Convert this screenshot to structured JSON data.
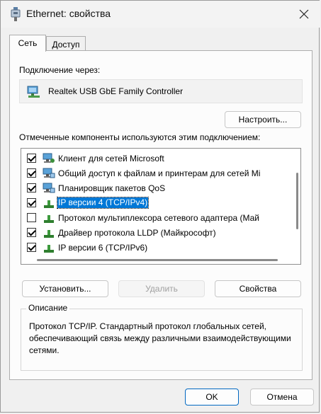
{
  "window": {
    "title": "Ethernet: свойства"
  },
  "tabs": [
    {
      "label": "Сеть"
    },
    {
      "label": "Доступ"
    }
  ],
  "connect_using": {
    "label": "Подключение через:",
    "adapter": "Realtek USB GbE Family Controller",
    "configure_button": "Настроить..."
  },
  "components": {
    "label": "Отмеченные компоненты используются этим подключением:",
    "items": [
      {
        "label": "Клиент для сетей Microsoft",
        "checked": true,
        "icon": "network-client-icon"
      },
      {
        "label": "Общий доступ к файлам и принтерам для сетей Mi",
        "checked": true,
        "icon": "network-service-icon"
      },
      {
        "label": "Планировщик пакетов QoS",
        "checked": true,
        "icon": "network-service-icon"
      },
      {
        "label": "IP версии 4 (TCP/IPv4)",
        "checked": true,
        "icon": "protocol-icon",
        "selected": true
      },
      {
        "label": "Протокол мультиплексора сетевого адаптера (Май",
        "checked": false,
        "icon": "protocol-icon"
      },
      {
        "label": "Драйвер протокола LLDP (Майкрософт)",
        "checked": true,
        "icon": "protocol-icon"
      },
      {
        "label": "IP версии 6 (TCP/IPv6)",
        "checked": true,
        "icon": "protocol-icon"
      }
    ]
  },
  "actions": {
    "install": "Установить...",
    "uninstall": "Удалить",
    "properties": "Свойства"
  },
  "description": {
    "title": "Описание",
    "text": "Протокол TCP/IP. Стандартный протокол глобальных сетей, обеспечивающий связь между различными взаимодействующими сетями."
  },
  "footer": {
    "ok": "OK",
    "cancel": "Отмена"
  },
  "colors": {
    "selection": "#0078d7",
    "default_button_border": "#0067c0"
  }
}
